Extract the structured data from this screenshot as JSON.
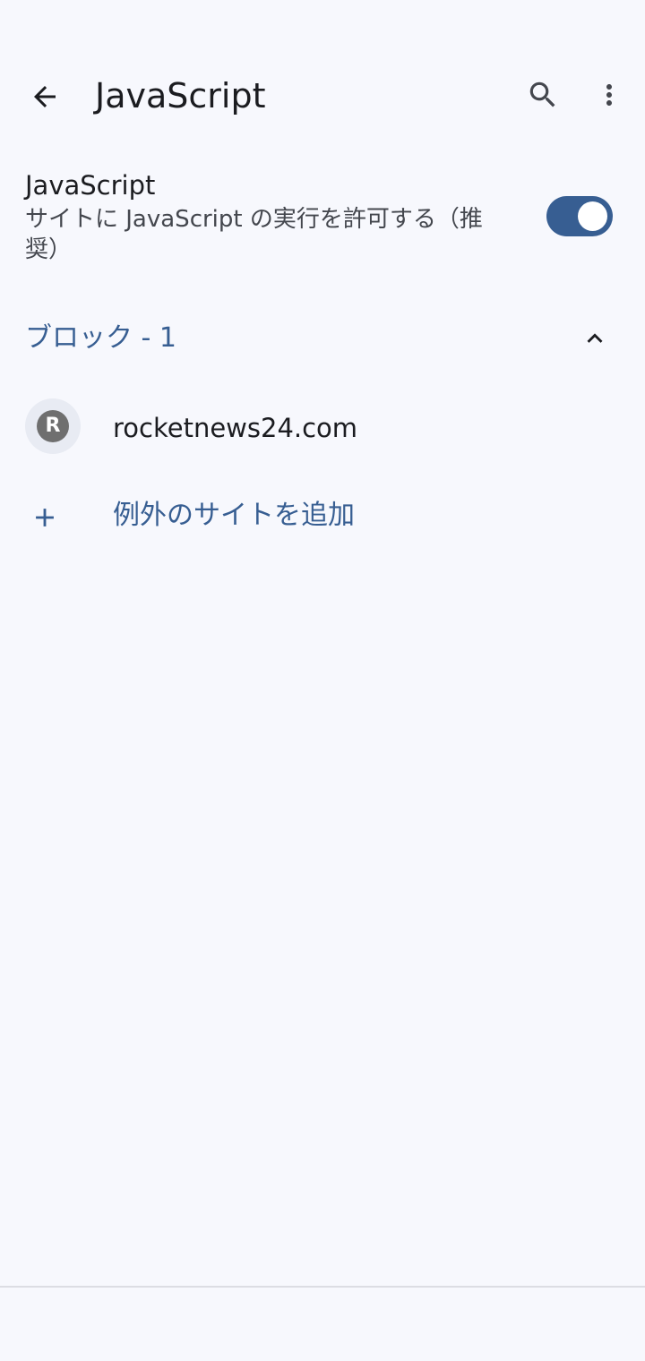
{
  "header": {
    "title": "JavaScript",
    "back_icon": "arrow-back-icon",
    "search_icon": "search-icon",
    "more_icon": "more-vert-icon"
  },
  "setting": {
    "title": "JavaScript",
    "summary": "サイトに JavaScript の実行を許可する（推奨）",
    "enabled": true
  },
  "blocked_section": {
    "title": "ブロック - 1",
    "expanded": true,
    "chevron_icon": "chevron-up-icon"
  },
  "sites": [
    {
      "avatar_letter": "R",
      "name": "rocketnews24.com"
    }
  ],
  "add_exception": {
    "label": "例外のサイトを追加",
    "icon": "add-icon"
  },
  "colors": {
    "background": "#f7f8fd",
    "accent": "#375e92",
    "text": "#1b1c20",
    "secondary_text": "#44474e"
  }
}
